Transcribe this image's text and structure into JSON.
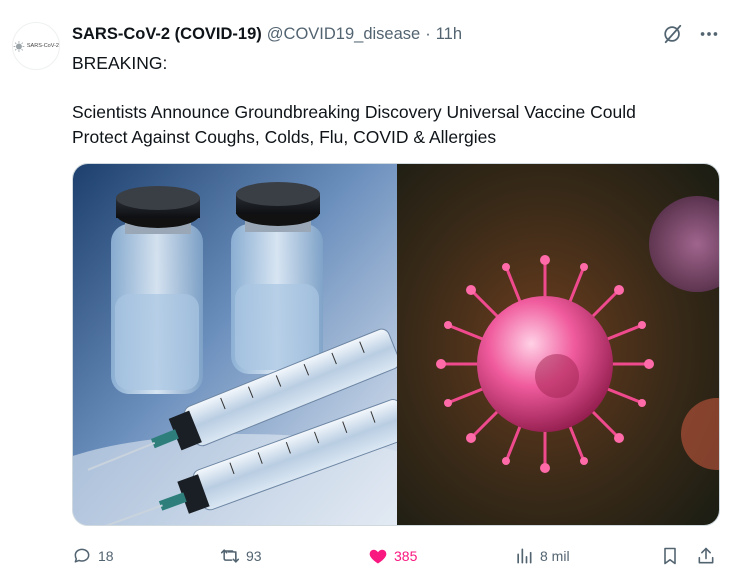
{
  "tweet": {
    "author": {
      "display_name": "SARS-CoV-2 (COVID-19)",
      "handle": "@COVID19_disease",
      "avatar_text": "SARS-CoV-2",
      "avatar_icon": "coronavirus-logo-icon"
    },
    "separator": "·",
    "time": "11h",
    "header_icons": [
      "grok-icon",
      "more-icon"
    ],
    "text_lines": [
      "BREAKING:",
      "Scientists Announce Groundbreaking Discovery  Universal Vaccine Could",
      "Protect Against Coughs, Colds, Flu, COVID & Allergies"
    ],
    "media": [
      {
        "icon": "vaccine-vials-syringes-image"
      },
      {
        "icon": "virus-particle-image"
      }
    ],
    "actions": {
      "replies": "18",
      "retweets": "93",
      "likes": "385",
      "views": "8 mil",
      "liked": true
    }
  },
  "colors": {
    "text_primary": "#0f1419",
    "text_secondary": "#536471",
    "like_active": "#f91880",
    "border": "#cfd9de"
  }
}
